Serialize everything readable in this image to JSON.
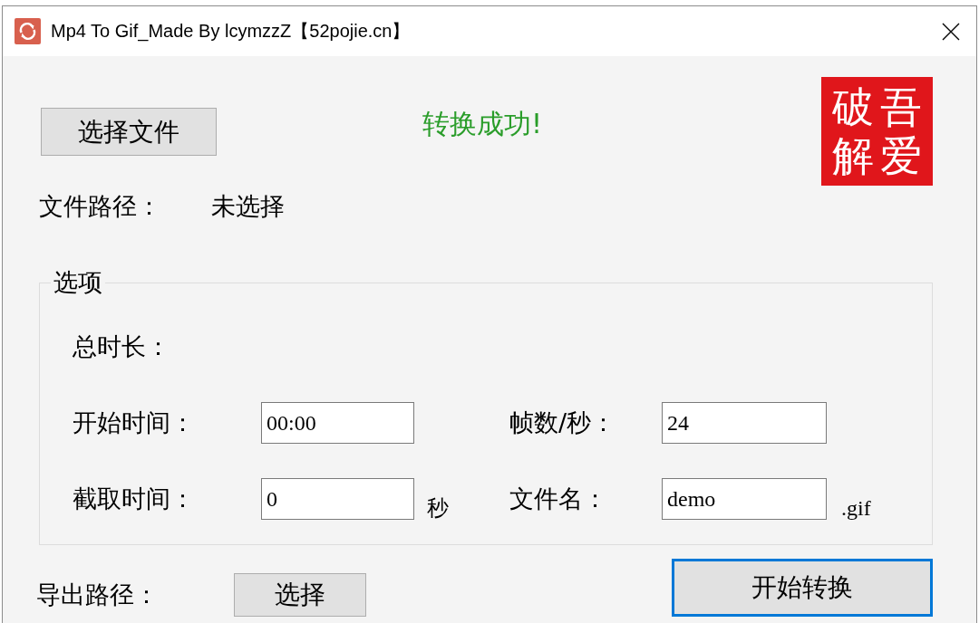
{
  "window": {
    "title": "Mp4 To Gif_Made By lcymzzZ【52pojie.cn】"
  },
  "header": {
    "select_file_button": "选择文件",
    "status": "转换成功!",
    "seal": "吾爱破解"
  },
  "file_path": {
    "label": "文件路径：",
    "value": "未选择"
  },
  "options": {
    "title": "选项",
    "total_duration_label": "总时长：",
    "fields": [
      {
        "label": "开始时间：",
        "value": "00:00"
      },
      {
        "label": "帧数/秒：",
        "value": "24"
      },
      {
        "label": "截取时间：",
        "value": "0",
        "suffix": "秒"
      },
      {
        "label": "文件名：",
        "value": "demo",
        "suffix": ".gif"
      }
    ]
  },
  "export": {
    "label": "导出路径：",
    "button": "选择"
  },
  "convert_button": {
    "label": "开始转换",
    "focused": true
  }
}
